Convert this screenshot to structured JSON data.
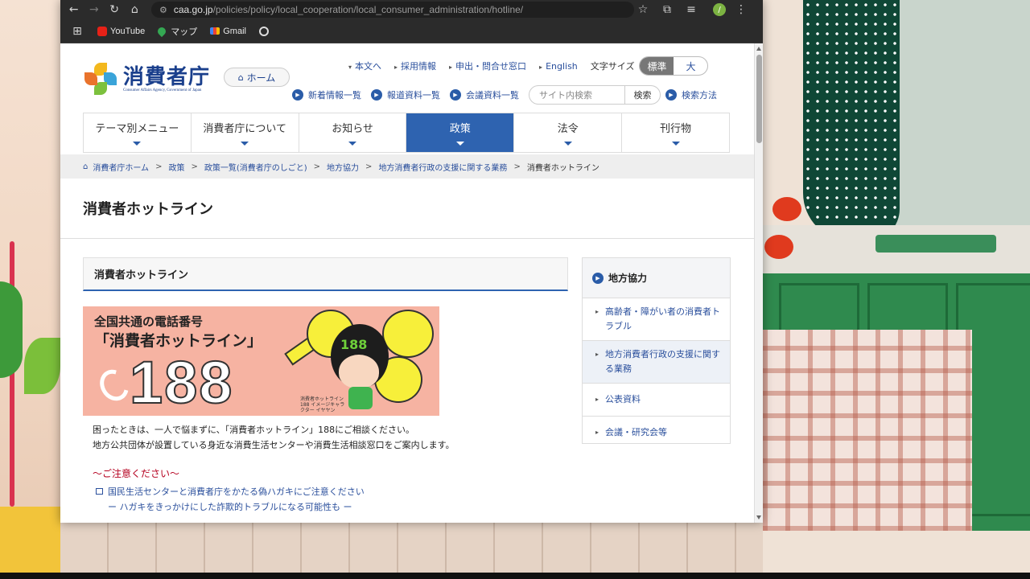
{
  "browser": {
    "url_host": "caa.go.jp",
    "url_path": "/policies/policy/local_cooperation/local_consumer_administration/hotline/",
    "avatar_letter": "/",
    "bookmarks": [
      "YouTube",
      "マップ",
      "Gmail"
    ]
  },
  "site": {
    "logo_title": "消費者庁",
    "logo_subtitle": "Consumer Affairs Agency, Government of Japan",
    "home_button": "ホーム",
    "top_links": [
      "本文へ",
      "採用情報",
      "申出・問合せ窓口",
      "English"
    ],
    "font_size_label": "文字サイズ",
    "font_size_options": [
      "標準",
      "大"
    ],
    "sub_links": [
      "新着情報一覧",
      "報道資料一覧",
      "会議資料一覧"
    ],
    "search_placeholder": "サイト内検索",
    "search_button": "検索",
    "search_help": "検索方法"
  },
  "nav": [
    "テーマ別メニュー",
    "消費者庁について",
    "お知らせ",
    "政策",
    "法令",
    "刊行物"
  ],
  "nav_active": "政策",
  "breadcrumb": [
    "消費者庁ホーム",
    "政策",
    "政策一覧(消費者庁のしごと)",
    "地方協力",
    "地方消費者行政の支援に関する業務",
    "消費者ホットライン"
  ],
  "page": {
    "title": "消費者ホットライン",
    "section_title": "消費者ホットライン",
    "banner": {
      "line1": "全国共通の電話番号",
      "line2": "「消費者ホットライン」",
      "number": "188",
      "hat_number": "188",
      "caption": "消費者ホットライン188 イメージキャラクター イヤヤン"
    },
    "body_line1": "困ったときは、一人で悩まずに、「消費者ホットライン」188にご相談ください。",
    "body_line2": "地方公共団体が設置している身近な消費生活センターや消費生活相談窓口をご案内します。",
    "notice_title": "〜ご注意ください〜",
    "notice_link1": "国民生活センターと消費者庁をかたる偽ハガキにご注意ください",
    "notice_link2": "ー ハガキをきっかけにした詐欺的トラブルになる可能性も ー"
  },
  "sidebar": {
    "title": "地方協力",
    "items": [
      "高齢者・障がい者の消費者トラブル",
      "地方消費者行政の支援に関する業務",
      "公表資料",
      "会議・研究会等"
    ]
  },
  "colors": {
    "brand_blue": "#1a3f8c",
    "nav_active": "#2e63b0",
    "notice_red": "#b5001f",
    "banner_bg": "#f6b3a2"
  }
}
